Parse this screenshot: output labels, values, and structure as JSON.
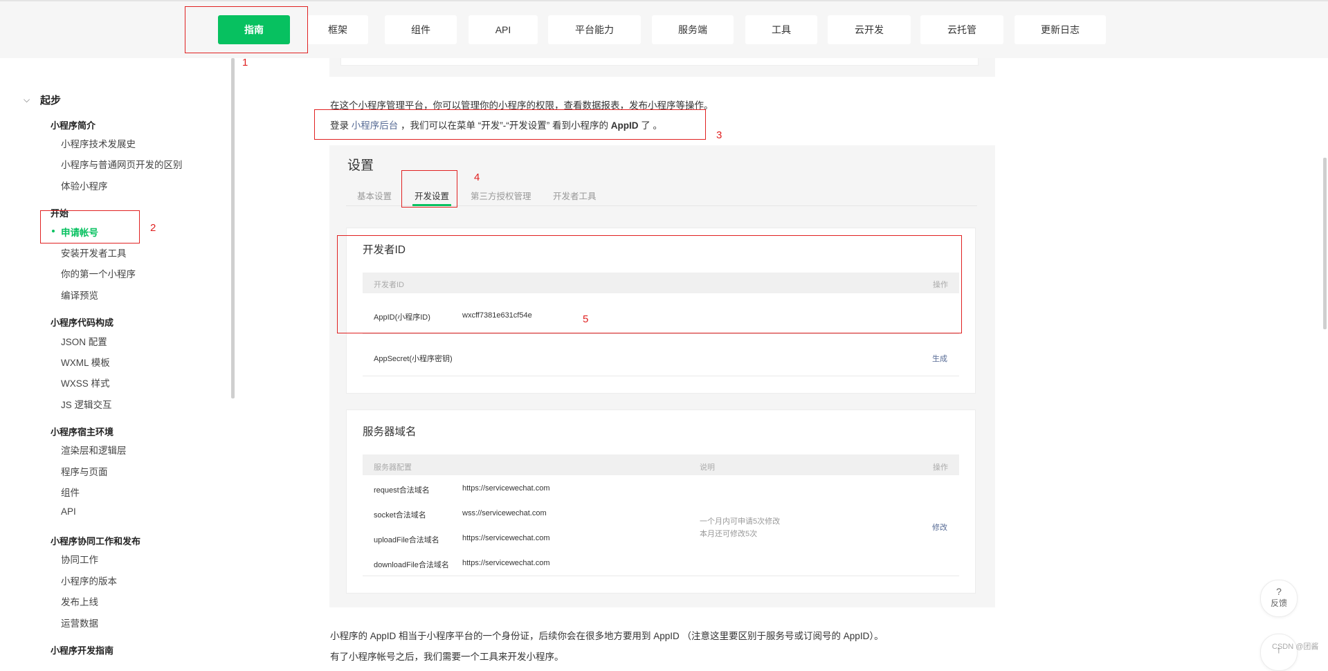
{
  "nav": {
    "items": [
      "指南",
      "框架",
      "组件",
      "API",
      "平台能力",
      "服务端",
      "工具",
      "云开发",
      "云托管",
      "更新日志"
    ],
    "active_index": 0
  },
  "sidebar": {
    "section_title": "起步",
    "groups": [
      {
        "title": "小程序简介",
        "items": [
          "小程序技术发展史",
          "小程序与普通网页开发的区别",
          "体验小程序"
        ]
      },
      {
        "title": "开始",
        "items": [
          "申请帐号",
          "安装开发者工具",
          "你的第一个小程序",
          "编译预览"
        ]
      },
      {
        "title": "小程序代码构成",
        "items": [
          "JSON 配置",
          "WXML 模板",
          "WXSS 样式",
          "JS 逻辑交互"
        ]
      },
      {
        "title": "小程序宿主环境",
        "items": [
          "渲染层和逻辑层",
          "程序与页面",
          "组件",
          "API"
        ]
      },
      {
        "title": "小程序协同工作和发布",
        "items": [
          "协同工作",
          "小程序的版本",
          "发布上线",
          "运营数据"
        ]
      },
      {
        "title": "小程序开发指南",
        "items": []
      }
    ],
    "current_item": "申请帐号"
  },
  "content": {
    "para1": "在这个小程序管理平台，你可以管理你的小程序的权限，查看数据报表，发布小程序等操作。",
    "para2_prefix": "登录 ",
    "para2_link": "小程序后台",
    "para2_mid": " ，我们可以在菜单 “开发”-“开发设置” 看到小程序的 ",
    "para2_bold": "AppID",
    "para2_suffix": " 了 。",
    "para3": "小程序的 AppID 相当于小程序平台的一个身份证，后续你会在很多地方要用到 AppID （注意这里要区别于服务号或订阅号的 AppID）。",
    "para4": "有了小程序帐号之后，我们需要一个工具来开发小程序。"
  },
  "screenshot": {
    "title": "设置",
    "tabs": [
      "基本设置",
      "开发设置",
      "第三方授权管理",
      "开发者工具"
    ],
    "active_tab": 1,
    "dev_id": {
      "title": "开发者ID",
      "header_name": "开发者ID",
      "header_action": "操作",
      "rows": [
        {
          "name": "AppID(小程序ID)",
          "value": "wxcff7381e631cf54e",
          "action": ""
        },
        {
          "name": "AppSecret(小程序密钥)",
          "value": "",
          "action": "生成"
        }
      ]
    },
    "server": {
      "title": "服务器域名",
      "header_config": "服务器配置",
      "header_desc": "说明",
      "header_action": "操作",
      "rows": [
        {
          "name": "request合法域名",
          "value": "https://servicewechat.com"
        },
        {
          "name": "socket合法域名",
          "value": "wss://servicewechat.com"
        },
        {
          "name": "uploadFile合法域名",
          "value": "https://servicewechat.com"
        },
        {
          "name": "downloadFile合法域名",
          "value": "https://servicewechat.com"
        }
      ],
      "note_line1": "一个月内可申请5次修改",
      "note_line2": "本月还可修改5次",
      "action": "修改"
    }
  },
  "annotations": [
    "1",
    "2",
    "3",
    "4",
    "5"
  ],
  "floating": {
    "help_icon": "?",
    "feedback_label": "反馈",
    "top_icon": "↑"
  },
  "watermark": "CSDN @团酱",
  "colors": {
    "accent": "#07c160",
    "annotation": "#e02020",
    "link": "#576b95"
  }
}
